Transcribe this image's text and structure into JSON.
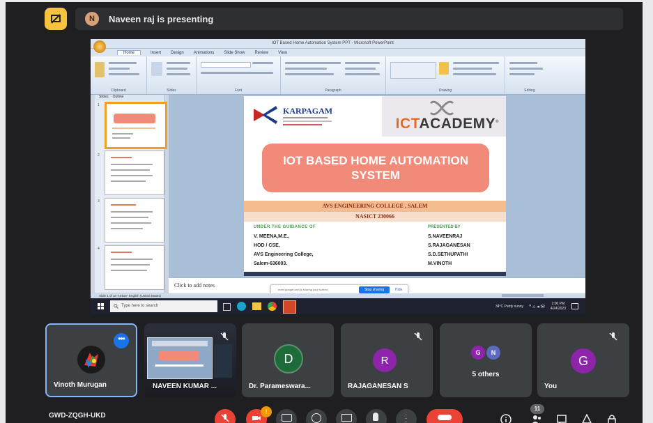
{
  "window": {
    "presenting_text": "Naveen raj is presenting",
    "presenter_initial": "N"
  },
  "powerpoint": {
    "title_bar": "IOT Based Home Automation System PPT - Microsoft PowerPoint",
    "ribbon_tabs": [
      "Home",
      "Insert",
      "Design",
      "Animations",
      "Slide Show",
      "Review",
      "View"
    ],
    "ribbon_groups": [
      "Clipboard",
      "Slides",
      "Font",
      "Paragraph",
      "Drawing",
      "Editing"
    ],
    "pane_tabs": [
      "Slides",
      "Outline"
    ],
    "notes_placeholder": "Click to add notes",
    "status_bar": "Slide 1 of 10    \"Urban\"    English (United States)",
    "slide": {
      "institution_name": "KARPAGAM",
      "academy_left": "ICT",
      "academy_right": "ACADEMY",
      "trademark": "®",
      "title_line1": "IOT BASED HOME AUTOMATION",
      "title_line2": "SYSTEM",
      "college": "AVS ENGINEERING COLLEGE , SALEM",
      "code": "NASICT 230066",
      "guidance_heading": "UNDER THE GUIDANCE OF",
      "guidance_lines": [
        "V. MEENA,M.E.,",
        "HOD / CSE,",
        "AVS Engineering College,",
        "Salem-636003."
      ],
      "presented_heading": "PRESENTED BY",
      "presented_lines": [
        "S.NAVEENRAJ",
        "S.RAJAGANESAN",
        "S.D.SETHUPATHI",
        "M.VINOTH"
      ]
    },
    "share_bar": {
      "message": "meet.google.com is sharing your screen.",
      "stop_label": "Stop sharing",
      "hide_label": "Hide"
    }
  },
  "taskbar": {
    "search_placeholder": "Type here to search",
    "weather": "34°C Partly sunny",
    "time": "2:00 PM",
    "date": "4/24/2023"
  },
  "participants": [
    {
      "name": "Vinoth Murugan",
      "type": "photo"
    },
    {
      "name": "NAVEEN KUMAR ...",
      "type": "video"
    },
    {
      "name": "Dr. Parameswara...",
      "initial": "D",
      "color": "#1e6b3a"
    },
    {
      "name": "RAJAGANESAN S",
      "initial": "R",
      "color": "#8e24aa"
    },
    {
      "name": "5 others",
      "initials": [
        "G",
        "N"
      ],
      "colors": [
        "#8e24aa",
        "#5c6bc0"
      ]
    },
    {
      "name": "You",
      "initial": "G",
      "color": "#8e24aa"
    }
  ],
  "controls": {
    "meeting_code": "GWD-ZQGH-UKD",
    "participant_count": "11",
    "notification_badge": "!"
  },
  "colors": {
    "accent": "#1a73e8",
    "danger": "#ea4335",
    "present_button": "#f6c33f"
  }
}
